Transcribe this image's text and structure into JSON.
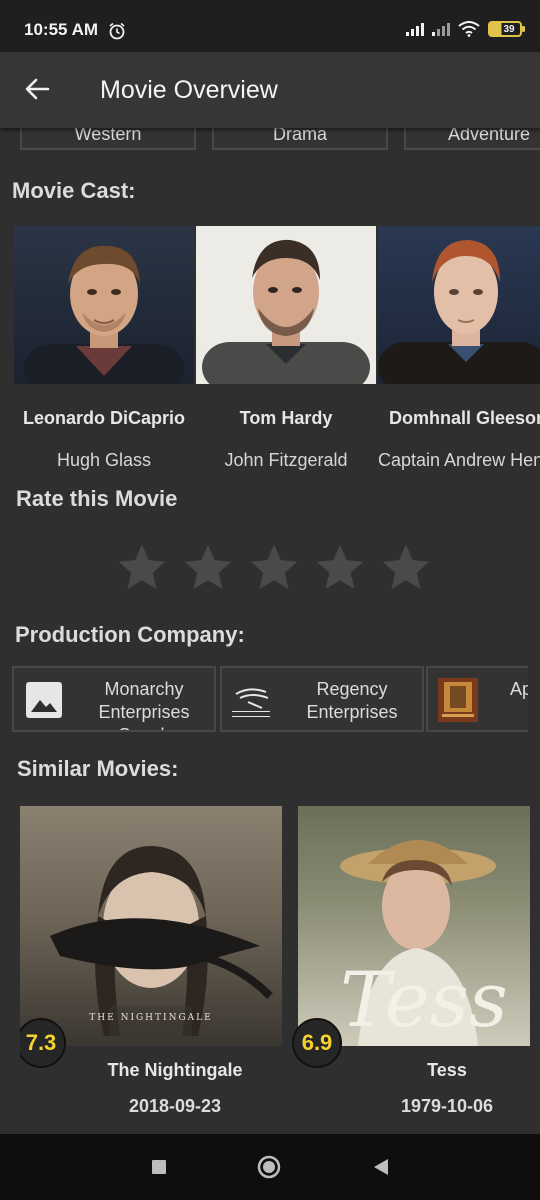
{
  "status_bar": {
    "time": "10:55 AM",
    "battery": "39",
    "icons": [
      "alarm-icon",
      "signal-icon",
      "signal-icon",
      "wifi-icon",
      "battery-icon"
    ]
  },
  "app_bar": {
    "title": "Movie Overview",
    "back_icon": "arrow-left-icon"
  },
  "genres": [
    "Western",
    "Drama",
    "Adventure"
  ],
  "cast_section": {
    "title": "Movie Cast:",
    "members": [
      {
        "name": "Leonardo DiCaprio",
        "role": "Hugh Glass"
      },
      {
        "name": "Tom Hardy",
        "role": "John Fitzgerald"
      },
      {
        "name": "Domhnall Gleeson",
        "role": "Captain Andrew Henry"
      }
    ]
  },
  "rating_section": {
    "title": "Rate this Movie",
    "stars": 5,
    "selected": 0
  },
  "production_section": {
    "title": "Production Company:",
    "companies": [
      {
        "name": "Monarchy Enterprises S.a.r.l.",
        "logo": "image-placeholder-icon"
      },
      {
        "name": "Regency Enterprises",
        "logo": "regency-logo"
      },
      {
        "name": "Appian Way",
        "logo": "appian-way-logo"
      }
    ]
  },
  "similar_section": {
    "title": "Similar Movies:",
    "movies": [
      {
        "title": "The Nightingale",
        "date": "2018-09-23",
        "rating": "7.3"
      },
      {
        "title": "Tess",
        "date": "1979-10-06",
        "rating": "6.9"
      }
    ]
  },
  "nav_bar": {
    "icons": [
      "recent-apps-icon",
      "home-icon",
      "back-icon"
    ]
  },
  "colors": {
    "background": "#2f2f2f",
    "app_bar": "#363636",
    "rating_text": "#f6d32d",
    "star": "#4a4a4a"
  }
}
